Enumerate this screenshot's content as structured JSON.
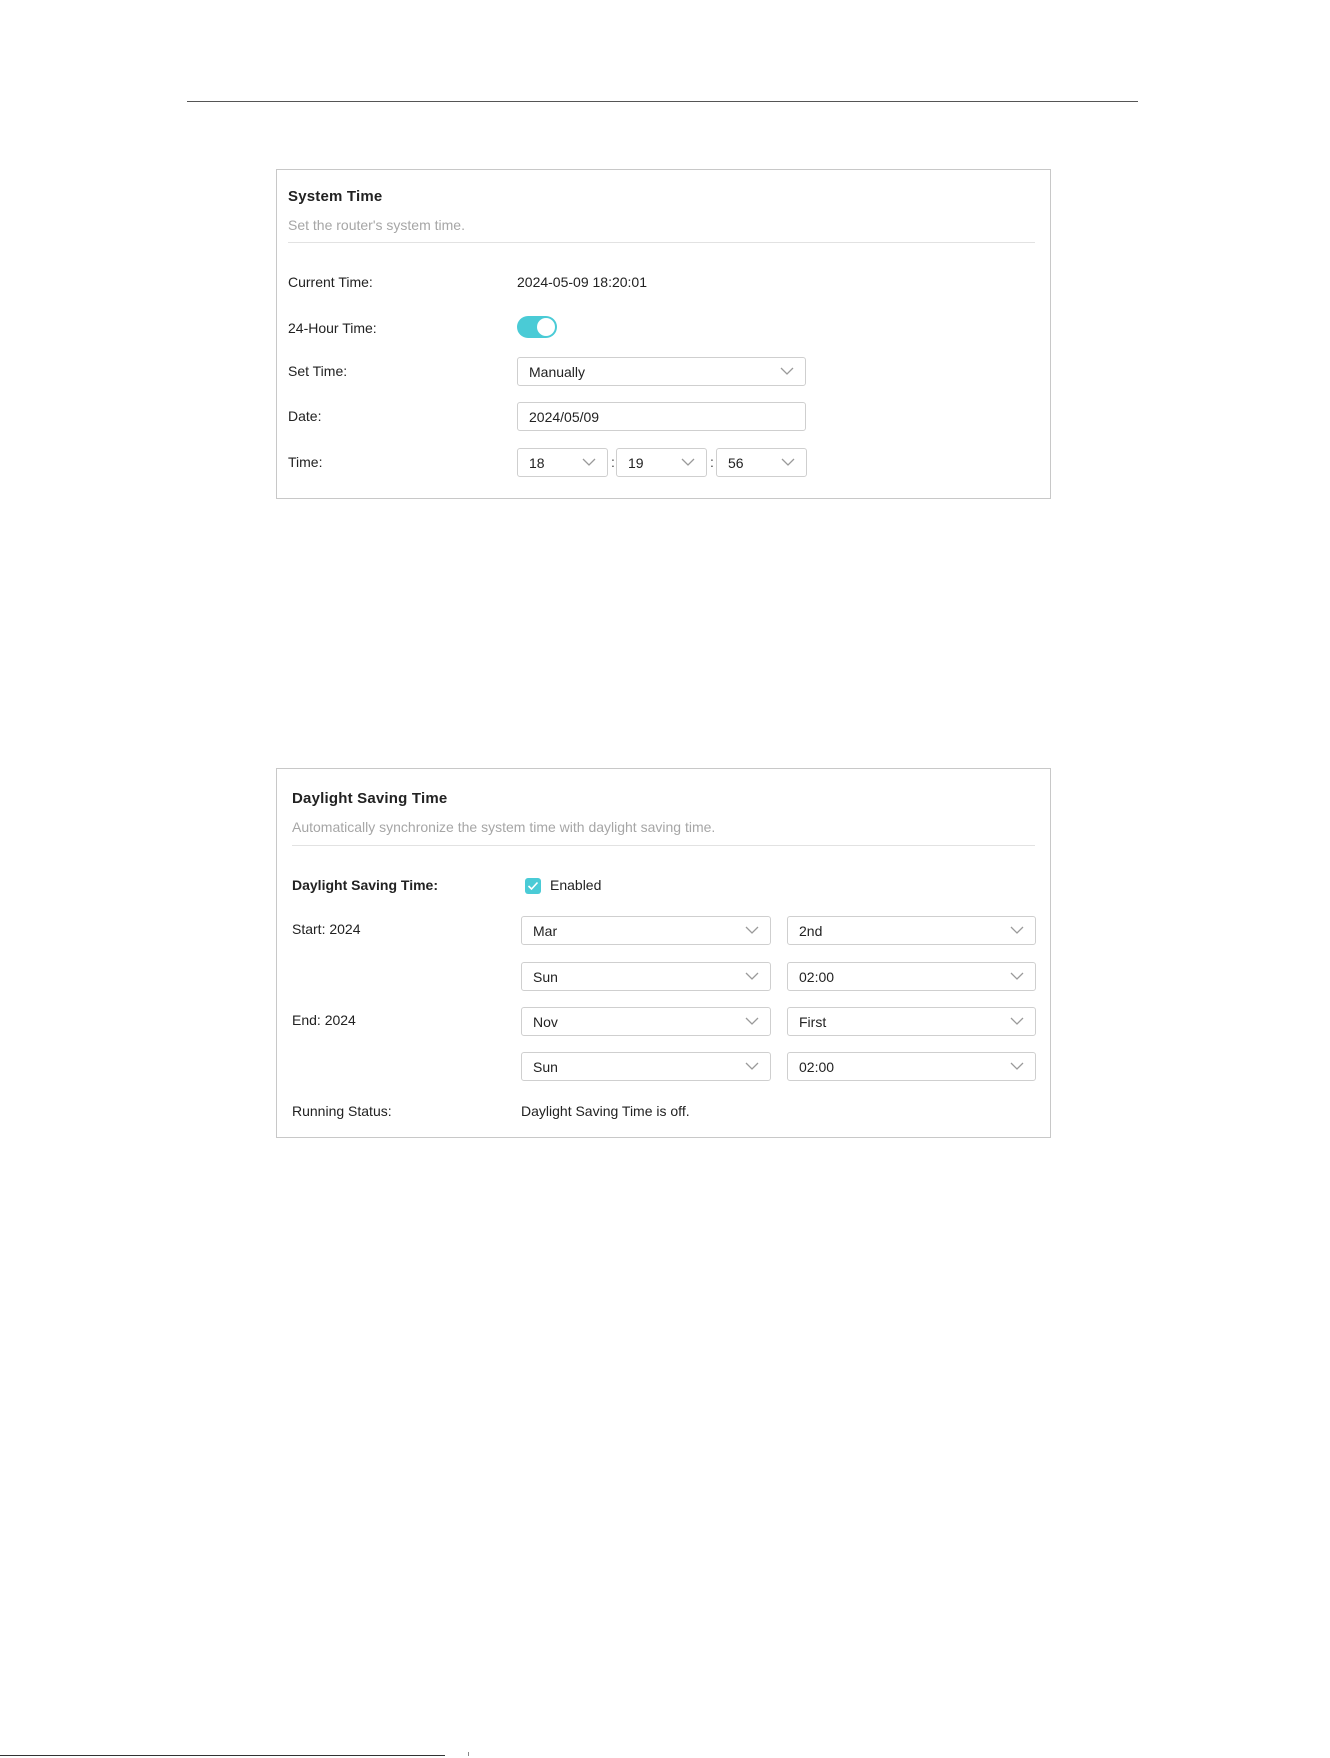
{
  "colors": {
    "accent": "#4acbd6",
    "border": "#c8c8c8",
    "muted_text": "#a6a6a6"
  },
  "system_time": {
    "title": "System Time",
    "description": "Set the router's system time.",
    "current_time_label": "Current Time:",
    "current_time_value": "2024-05-09 18:20:01",
    "hour24_label": "24-Hour Time:",
    "hour24_enabled": true,
    "set_time_label": "Set Time:",
    "set_time_value": "Manually",
    "date_label": "Date:",
    "date_value": "2024/05/09",
    "time_label": "Time:",
    "hour_value": "18",
    "minute_value": "19",
    "second_value": "56",
    "time_separator": ":"
  },
  "dst": {
    "title": "Daylight Saving Time",
    "description": "Automatically synchronize the system time with daylight saving time.",
    "enable_label": "Daylight Saving Time:",
    "enabled_text": "Enabled",
    "enabled": true,
    "start_label": "Start: 2024",
    "start_month": "Mar",
    "start_week": "2nd",
    "start_day": "Sun",
    "start_time": "02:00",
    "end_label": "End: 2024",
    "end_month": "Nov",
    "end_week": "First",
    "end_day": "Sun",
    "end_time": "02:00",
    "running_status_label": "Running Status:",
    "running_status_value": "Daylight Saving Time is off."
  },
  "icons": {
    "dropdown": "chevron-down-icon",
    "toggle": "toggle-switch",
    "check": "check-icon"
  }
}
